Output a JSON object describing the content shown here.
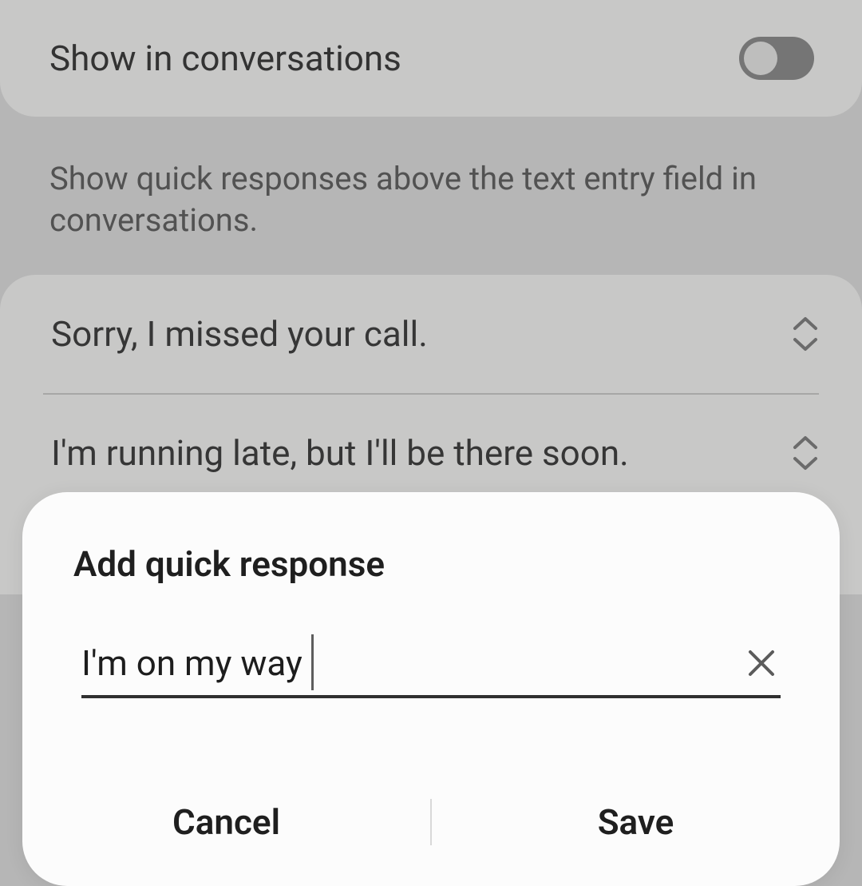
{
  "settings": {
    "toggle_label": "Show in conversations",
    "toggle_on": false,
    "description": "Show quick responses above the text entry field in conversations."
  },
  "responses": [
    {
      "text": "Sorry, I missed your call."
    },
    {
      "text": "I'm running late, but I'll be there soon."
    }
  ],
  "dialog": {
    "title": "Add quick response",
    "input_value": "I'm on my way",
    "cancel_label": "Cancel",
    "save_label": "Save"
  }
}
